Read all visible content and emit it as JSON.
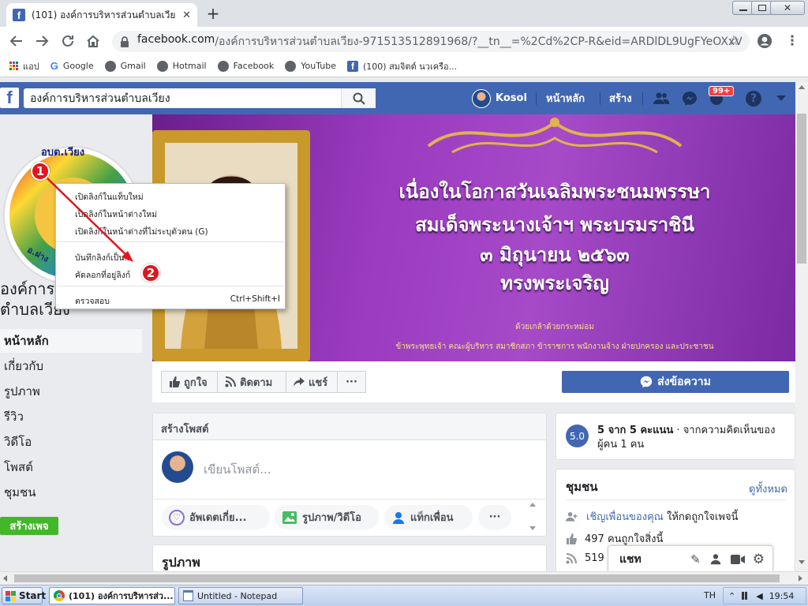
{
  "browser": {
    "tab_title": "(101) องค์การบริหารส่วนตำบลเวียง - ห",
    "url_host": "facebook.com",
    "url_path": "/องค์การบริหารส่วนตำบลเวียง-971513512891968/?__tn__=%2Cd%2CP-R&eid=ARDlDL9UgFYeOXxVyEg...",
    "bookmarks": [
      "แอป",
      "Google",
      "Gmail",
      "Hotmail",
      "Facebook",
      "YouTube",
      "(100) สมจิตต์ นวเครือ..."
    ]
  },
  "fb": {
    "search_value": "องค์การบริหารส่วนตำบลเวียง",
    "user_name": "Kosol",
    "nav_home": "หน้าหลัก",
    "nav_create": "สร้าง",
    "notif_count": "99+",
    "colors": {
      "brand": "#4267b2",
      "like_green": "#42b72a",
      "badge_red": "#e0151f"
    }
  },
  "page": {
    "logo_text_top": "อบต.เวียง",
    "logo_text_bottom": "อ.ฝาง",
    "name_line1": "องค์การบ",
    "name_line2": "ตำบลเวียง",
    "nav_items": [
      "หน้าหลัก",
      "เกี่ยวกับ",
      "รูปภาพ",
      "รีวิว",
      "วิดีโอ",
      "โพสต์",
      "ชุมชน"
    ],
    "create_page_button": "สร้างเพจ"
  },
  "cover": {
    "line1": "เนื่องในโอกาสวันเฉลิมพระชนมพรรษา",
    "line2": "สมเด็จพระนางเจ้าฯ พระบรมราชินี",
    "line3": "๓ มิถุนายน ๒๕๖๓",
    "line4": "ทรงพระเจริญ",
    "sub1": "ด้วยเกล้าด้วยกระหม่อม",
    "sub2": "ข้าพระพุทธเจ้า คณะผู้บริหาร สมาชิกสภา ข้าราชการ พนักงานจ้าง ฝ่ายปกครอง และประชาชน"
  },
  "actions": {
    "like": "ถูกใจ",
    "follow": "ติดตาม",
    "share": "แชร์",
    "more": "···",
    "message": "ส่งข้อความ"
  },
  "create_post": {
    "title": "สร้างโพสต์",
    "placeholder": "เขียนโพสต์...",
    "pill_update": "อัพเดตเกี่ย...",
    "pill_photo": "รูปภาพ/วิดีโอ",
    "pill_tag": "แท็กเพื่อน",
    "pill_more": "···"
  },
  "photos_title": "รูปภาพ",
  "rating": {
    "score": "5.0",
    "headline": "5 จาก 5 คะแนน",
    "detail_a": " · จากความคิดเห็นของ",
    "detail_b": "ผู้คน 1 คน"
  },
  "community": {
    "title": "ชุมชน",
    "see_all": "ดูทั้งหมด",
    "invite_link": "เชิญเพื่อนของคุณ",
    "invite_rest": " ให้กดถูกใจเพจนี้",
    "likes": "497 คนถูกใจสิ่งนี้",
    "follows": "519"
  },
  "chat": {
    "label": "แชท"
  },
  "context_menu": {
    "items": [
      "เปิดลิงก์ในแท็บใหม่",
      "เปิดลิงก์ในหน้าต่างใหม่",
      "เปิดลิงก์ในหน้าต่างที่ไม่ระบุตัวตน (G)",
      "บันทึกลิงก์เป็น...",
      "คัดลอกที่อยู่ลิงก์",
      "ตรวจสอบ"
    ],
    "inspect_shortcut": "Ctrl+Shift+I",
    "marker1": "1",
    "marker2": "2"
  },
  "taskbar": {
    "start": "Start",
    "task_chrome": "(101) องค์การบริหารส่ว...",
    "task_notepad": "Untitled - Notepad",
    "lang": "TH",
    "time": "19:54"
  }
}
